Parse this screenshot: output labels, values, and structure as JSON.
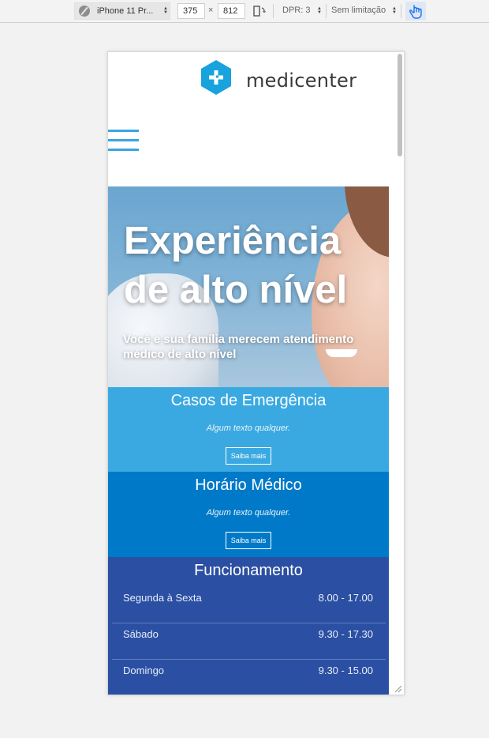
{
  "devtools": {
    "device": "iPhone 11 Pr...",
    "width": "375",
    "times": "×",
    "height": "812",
    "dpr": "DPR: 3",
    "throttle": "Sem limitação"
  },
  "site": {
    "brand": "medicenter",
    "hero": {
      "title": "Experiência de alto nível",
      "subtitle": "Você e sua família merecem atendimento médico de alto nível"
    },
    "emergency": {
      "title": "Casos de Emergência",
      "text": "Algum texto qualquer.",
      "button": "Saiba mais"
    },
    "schedule": {
      "title": "Horário Médico",
      "text": "Algum texto qualquer.",
      "button": "Saiba mais"
    },
    "hours": {
      "title": "Funcionamento",
      "rows": [
        {
          "day": "Segunda à Sexta",
          "time": "8.00 - 17.00"
        },
        {
          "day": "Sábado",
          "time": "9.30 - 17.30"
        },
        {
          "day": "Domingo",
          "time": "9.30 - 15.00"
        }
      ]
    }
  },
  "colors": {
    "accent": "#3aa5e1",
    "emergency_bg": "#3aa9e1",
    "schedule_bg": "#0079c8",
    "hours_bg": "#2b4fa2"
  }
}
